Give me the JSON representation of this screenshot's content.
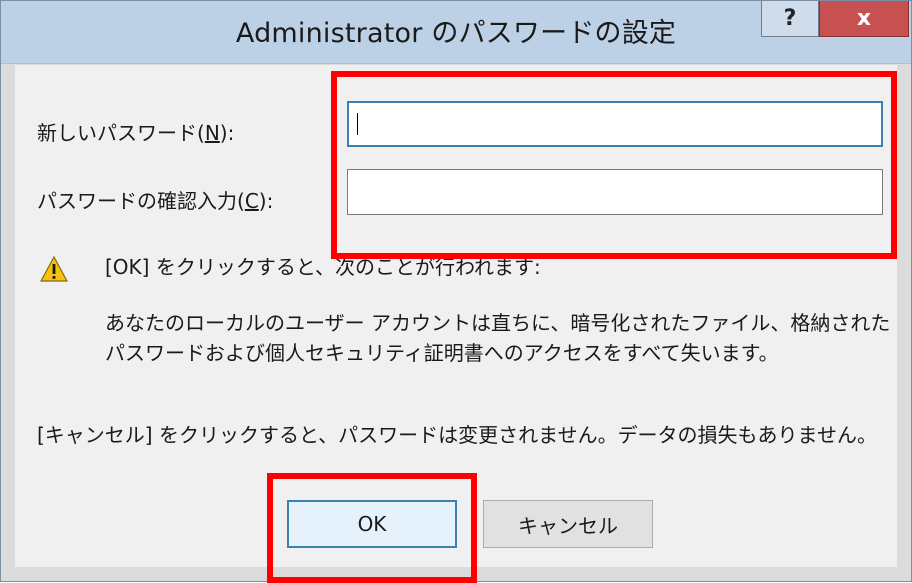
{
  "window": {
    "title": "Administrator のパスワードの設定",
    "help_glyph": "?",
    "close_glyph": "x"
  },
  "form": {
    "new_password_label": "新しいパスワード(",
    "new_password_key": "N",
    "new_password_suffix": "):",
    "new_password_value": "",
    "confirm_label": "パスワードの確認入力(",
    "confirm_key": "C",
    "confirm_suffix": "):",
    "confirm_value": ""
  },
  "messages": {
    "warning_text": "[OK] をクリックすると、次のことが行われます:",
    "consequence_line1": "あなたのローカルのユーザー アカウントは直ちに、暗号化されたファイル、格納された",
    "consequence_line2": "パスワードおよび個人セキュリティ証明書へのアクセスをすべて失います。",
    "cancel_info": "[キャンセル] をクリックすると、パスワードは変更されません。データの損失もありません。"
  },
  "buttons": {
    "ok": "OK",
    "cancel": "キャンセル"
  },
  "colors": {
    "highlight": "#ff0000",
    "titlebar": "#bcd1e6",
    "close": "#c75050",
    "focus": "#3c7fb1"
  },
  "icons": {
    "warning": "warning-icon",
    "help": "help-icon",
    "close": "close-icon"
  }
}
